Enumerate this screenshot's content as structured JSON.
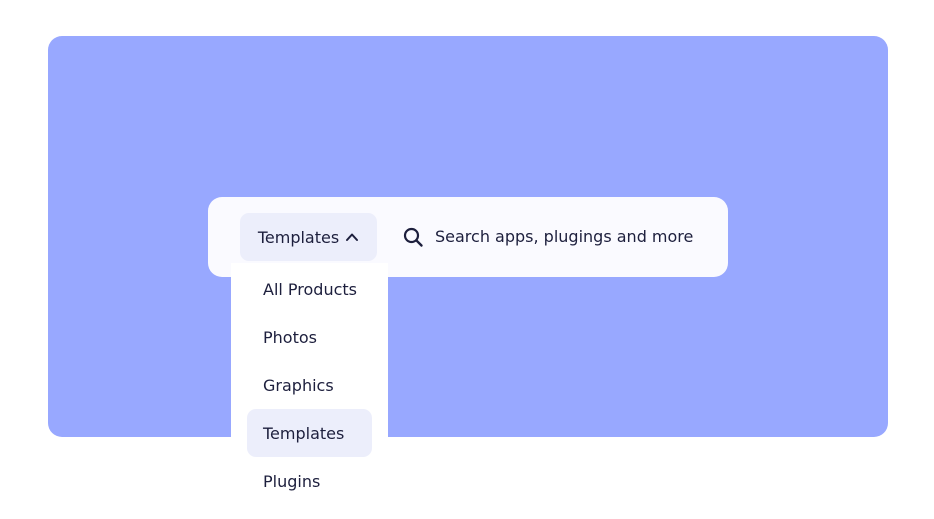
{
  "colors": {
    "hero_background": "#98a8ff",
    "search_background": "#fafaff",
    "selected_background": "#eceefb",
    "text": "#1d1f3d"
  },
  "search": {
    "category_label": "Templates",
    "category_icon": "chevron-up-icon",
    "search_icon": "search-icon",
    "placeholder": "Search apps, plugings and more"
  },
  "dropdown": {
    "items": [
      {
        "label": "All Products",
        "selected": false
      },
      {
        "label": "Photos",
        "selected": false
      },
      {
        "label": "Graphics",
        "selected": false
      },
      {
        "label": "Templates",
        "selected": true
      },
      {
        "label": "Plugins",
        "selected": false
      }
    ]
  }
}
